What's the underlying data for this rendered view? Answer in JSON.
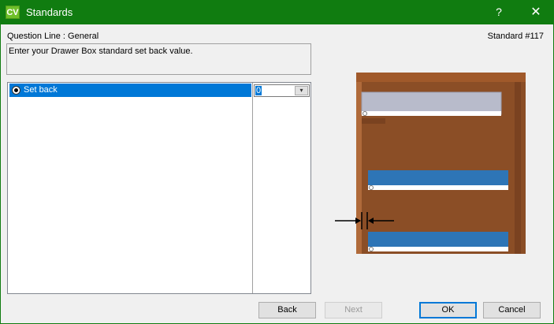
{
  "window": {
    "app_icon_text": "CV",
    "title": "Standards",
    "help_glyph": "?",
    "close_glyph": "✕"
  },
  "header": {
    "question_line": "Question Line : General",
    "standard_number": "Standard #117"
  },
  "description": "Enter your Drawer Box standard set back value.",
  "grid": {
    "rows": [
      {
        "label": "Set back",
        "value": "0",
        "selected": true
      }
    ],
    "dropdown_glyph": "▾"
  },
  "buttons": {
    "back": "Back",
    "next": "Next",
    "ok": "OK",
    "cancel": "Cancel"
  },
  "colors": {
    "titlebar": "#107c10",
    "selection": "#0078d7",
    "cabinet_wood": "#8b4e26",
    "drawer_front": "#2e75b6",
    "drawer_back": "#b8bbcb"
  },
  "illustration": {
    "icon_name": "drawer-setback-diagram"
  }
}
